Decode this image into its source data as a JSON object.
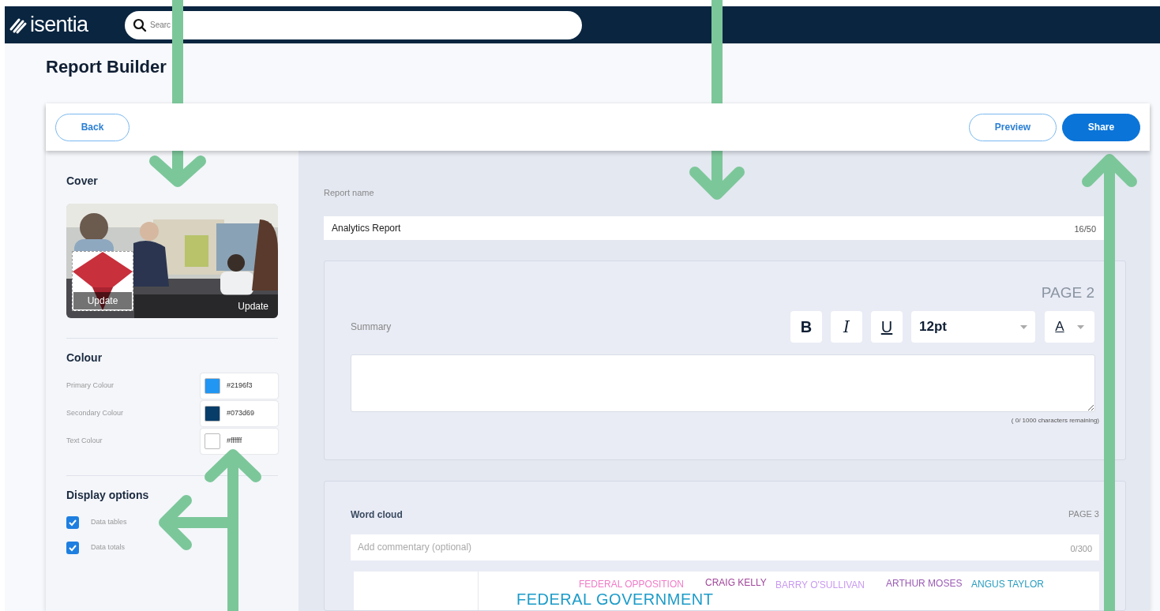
{
  "header": {
    "logo": "isentia",
    "search": {
      "placeholder": "Searc"
    }
  },
  "page_title": "Report Builder",
  "toolbar": {
    "back_button": "Back",
    "actions": [
      {
        "label": "Preview",
        "kind": "outline"
      },
      {
        "label": "Share",
        "kind": "filled"
      }
    ]
  },
  "sidebar": {
    "cover": {
      "title": "Cover",
      "update_labels": [
        "Update",
        "Update"
      ]
    },
    "colour": {
      "title": "Colour",
      "fields": [
        {
          "label": "Primary Colour",
          "value": "#2196f3",
          "color": "#2196f3"
        },
        {
          "label": "Secondary Colour",
          "value": "#073d69",
          "color": "#073d69"
        },
        {
          "label": "Text Colour",
          "value": "#ffffff",
          "color": "#ffffff"
        }
      ]
    },
    "display_options": {
      "title": "Display options",
      "options": [
        {
          "label": "Data tables",
          "checked": true
        },
        {
          "label": "Data totals",
          "checked": true
        }
      ]
    }
  },
  "report_name": {
    "label": "Report name",
    "value": "Analytics Report",
    "counter": "16/50"
  },
  "summary_section": {
    "page": "PAGE 2",
    "label": "Summary",
    "format_buttons": [
      {
        "label": "B",
        "kind": "bold"
      },
      {
        "label": "I",
        "kind": "italic"
      },
      {
        "label": "U",
        "kind": "underline"
      }
    ],
    "font_size": "12pt",
    "text_color_button": "A",
    "counter": "( 0/ 1000 characters remaining)"
  },
  "word_cloud_section": {
    "title": "Word cloud",
    "page": "PAGE 3",
    "commentary": {
      "placeholder": "Add commentary (optional)",
      "counter": "0/300"
    },
    "words": [
      {
        "text": "FEDERAL OPPOSITION",
        "color": "#f07cc8",
        "kind": "small"
      },
      {
        "text": "CRAIG KELLY",
        "color": "#a0479a",
        "kind": "small"
      },
      {
        "text": "BARRY O'SULLIVAN",
        "color": "#c89af0",
        "kind": "small"
      },
      {
        "text": "ARTHUR MOSES",
        "color": "#9b5bb5",
        "kind": "small"
      },
      {
        "text": "ANGUS TAYLOR",
        "color": "#2a9dc0",
        "kind": "small"
      },
      {
        "text": "FEDERAL GOVERNMENT",
        "color": "#1c9cc9",
        "kind": "large"
      }
    ]
  }
}
